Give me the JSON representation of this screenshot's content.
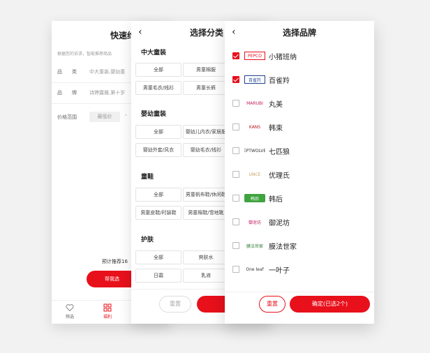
{
  "screen1": {
    "title": "快速约",
    "hint": "根据您的诉求，智能推荐商品",
    "rows": [
      {
        "label": "品　　类",
        "value": "中大童装,婴幼童"
      },
      {
        "label": "品　　牌",
        "value": "诗婷露雅,第十岁"
      }
    ],
    "price_label": "价格范围",
    "price_min_placeholder": "最低价",
    "price_dash": "-",
    "estimate": "预计推荐16",
    "help_button": "帮我选",
    "tabs": [
      {
        "label": "筛选",
        "icon": "heart-icon"
      },
      {
        "label": "福利",
        "icon": "grid-icon"
      }
    ],
    "accent": "#e8101b"
  },
  "screen2": {
    "back": "‹",
    "title": "选择分类",
    "sections": [
      {
        "title": "中大童装",
        "chips": [
          "全部",
          "男童棉服",
          "男童毛衣/线衫",
          "男童长裤"
        ]
      },
      {
        "title": "婴幼童装",
        "chips": [
          "全部",
          "婴幼儿内衣/家居服",
          "婴幼外套/风衣",
          "婴幼毛衣/线衫"
        ]
      },
      {
        "title": "童鞋",
        "chips": [
          "全部",
          "男童帆布鞋/休闲鞋",
          "男童皮鞋/时装鞋",
          "男童棉鞋/雪地靴"
        ]
      },
      {
        "title": "护肤",
        "chips": [
          "全部",
          "爽肤水",
          "日霜",
          "乳液"
        ]
      }
    ],
    "reset": "重置"
  },
  "screen3": {
    "back": "‹",
    "title": "选择品牌",
    "brands": [
      {
        "name": "小猪班纳",
        "logo": "PEPCO",
        "checked": true,
        "logo_color": "#e8101b"
      },
      {
        "name": "百雀羚",
        "logo": "百雀羚",
        "checked": true,
        "logo_color": "#1f3f8f"
      },
      {
        "name": "丸美",
        "logo": "MARUBI",
        "checked": false,
        "logo_color": "#c2185b"
      },
      {
        "name": "韩束",
        "logo": "KANS",
        "checked": false,
        "logo_color": "#b71c1c"
      },
      {
        "name": "七匹狼",
        "logo": "SEPTWOLVES",
        "checked": false,
        "logo_color": "#333333"
      },
      {
        "name": "优理氏",
        "logo": "UNCE",
        "checked": false,
        "logo_color": "#c8a26a"
      },
      {
        "name": "韩后",
        "logo": "韩后",
        "checked": false,
        "logo_color": "#3fa33f"
      },
      {
        "name": "御泥坊",
        "logo": "御泥坊",
        "checked": false,
        "logo_color": "#c2185b"
      },
      {
        "name": "膜法世家",
        "logo": "膜法世家",
        "checked": false,
        "logo_color": "#2e7d32"
      },
      {
        "name": "一叶子",
        "logo": "One leaf",
        "checked": false,
        "logo_color": "#333333"
      }
    ],
    "reset": "重置",
    "confirm": "确定(已选2个)"
  }
}
